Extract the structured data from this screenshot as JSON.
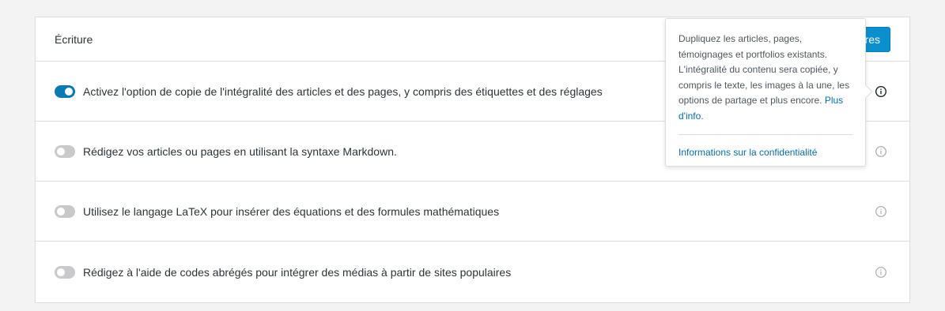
{
  "card": {
    "title": "Écriture",
    "save_label": "Enregistrer les réglages"
  },
  "rows": [
    {
      "label": "Activez l'option de copie de l'intégralité des articles et des pages, y compris des étiquettes et des réglages",
      "enabled": true
    },
    {
      "label": "Rédigez vos articles ou pages en utilisant la syntaxe Markdown.",
      "enabled": false
    },
    {
      "label": "Utilisez le langage LaTeX pour insérer des équations et des formules mathématiques",
      "enabled": false
    },
    {
      "label": "Rédigez à l'aide de codes abrégés pour intégrer des médias à partir de sites populaires",
      "enabled": false
    }
  ],
  "popover": {
    "text": "Dupliquez les articles, pages, témoignages et portfolios existants. L'intégralité du contenu sera copiée, y compris le texte, les images à la une, les options de partage et plus encore.",
    "more_link": "Plus d'info.",
    "privacy_link": "Informations sur la confidentialité"
  },
  "colors": {
    "accent": "#0a7ab3",
    "toggle_off": "#c9c9cb",
    "save_button": "#0a8fcf",
    "link": "#0a6ca0"
  },
  "icons": {
    "row_icon": "info-circle-icon"
  }
}
